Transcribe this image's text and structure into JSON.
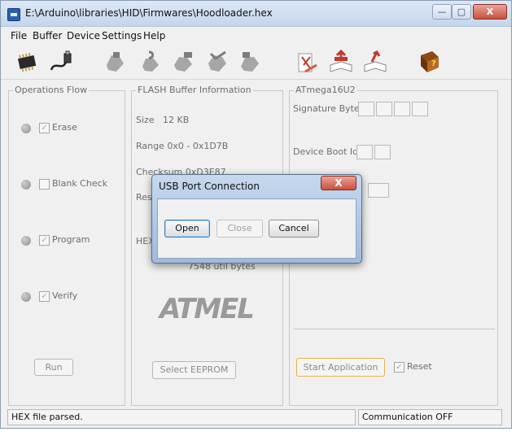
{
  "window": {
    "title": "E:\\Arduino\\libraries\\HID\\Firmwares\\Hoodloader.hex",
    "minimize_glyph": "—",
    "restore_glyph": "▢",
    "close_glyph": "X"
  },
  "menu": {
    "items": [
      "File",
      "Buffer",
      "Device",
      "Settings",
      "Help"
    ]
  },
  "toolbar": {
    "icons": [
      "chip-icon",
      "usb-cable-icon",
      "erase-hand-icon",
      "blank-check-hand-icon",
      "program-hand-icon",
      "verify-hand-icon",
      "read-hand-icon",
      "load-hex-icon",
      "save-hex-icon",
      "help-book-icon"
    ]
  },
  "operations": {
    "title": "Operations Flow",
    "erase": "Erase",
    "blank_check": "Blank Check",
    "program": "Program",
    "verify": "Verify",
    "run_label": "Run"
  },
  "flash": {
    "title": "FLASH Buffer Information",
    "size_label": "Size",
    "size_value": "12 KB",
    "range_text": "Range 0x0 - 0x1D7B",
    "checksum_text": "Checksum 0xD3E87",
    "reset_text": "Res",
    "hex_text": "HEX",
    "bytes_text": "7548 util bytes",
    "logo_text": "ATMEL",
    "select_eeprom_label": "Select EEPROM"
  },
  "device": {
    "title": "ATmega16U2",
    "signature_label": "Signature Bytes",
    "boot_ids_label": "Device Boot Ids",
    "start_app_label": "Start Application",
    "reset_label": "Reset"
  },
  "status": {
    "left": "HEX file parsed.",
    "right": "Communication OFF"
  },
  "dialog": {
    "title": "USB Port Connection",
    "close_glyph": "X",
    "open_label": "Open",
    "close_label": "Close",
    "cancel_label": "Cancel"
  },
  "colors": {
    "titlebar": "#c4d6ec",
    "close_button": "#c9513f",
    "start_app_border": "#e0b64a"
  }
}
